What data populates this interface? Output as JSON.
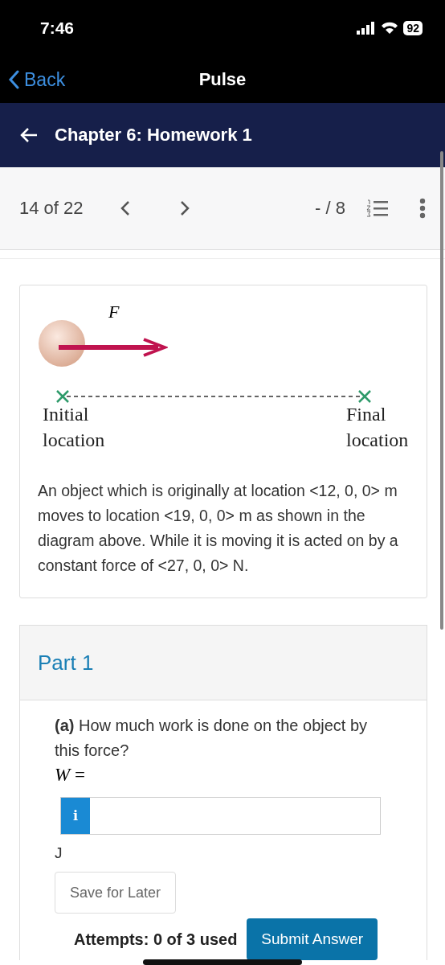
{
  "status_bar": {
    "time": "7:46",
    "battery": "92"
  },
  "nav_bar": {
    "back": "Back",
    "title": "Pulse"
  },
  "header": {
    "title": "Chapter 6: Homework 1"
  },
  "toolbar": {
    "position": "14 of 22",
    "score": "- / 8"
  },
  "problem": {
    "figure": {
      "force_label": "F",
      "start_label": "Initial location",
      "end_label": "Final location"
    },
    "text": "An object which is originally at location <12, 0, 0> m moves to location <19, 0, 0> m as shown in the diagram above. While it is moving it is acted on by a constant force of <27, 0, 0> N."
  },
  "part": {
    "title": "Part 1",
    "question": "**(a)** How much work is done on the object by this force?",
    "variable": "*W* =",
    "info_label": "i",
    "unit": "J",
    "save_button": "Save for Later",
    "attempts": "Attempts: 0 of 3 used",
    "submit_button": "Submit Answer"
  }
}
